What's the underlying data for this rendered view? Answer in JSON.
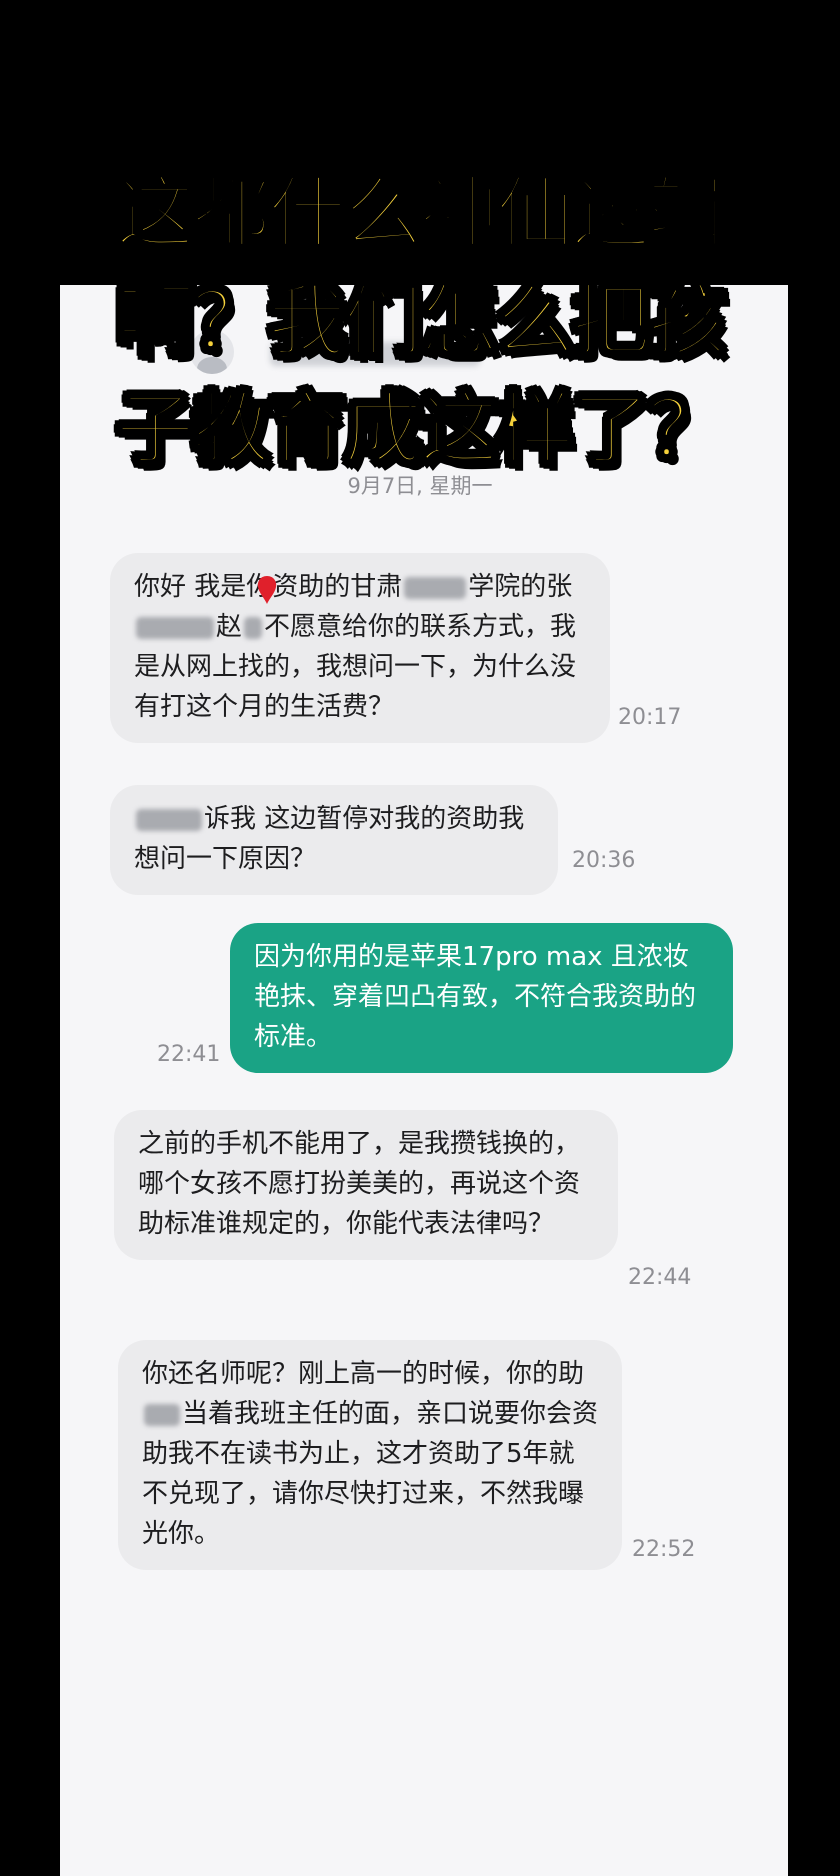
{
  "overlay": {
    "lines": [
      "这都什么神仙逻辑",
      "啊？我们怎么把孩",
      "子教育成这样了？"
    ]
  },
  "chat": {
    "date": "9月7日, 星期一",
    "messages": [
      {
        "dir": "in",
        "parts": [
          "你好 我是你资助的甘肃",
          "学院的张",
          "赵",
          "不愿意给你的联系方式，我是从网上找的，我想问一下，为什么没有打这个月的生活费？"
        ],
        "time": "20:17"
      },
      {
        "dir": "in",
        "parts": [
          "诉我 这边暂停对我的资助我想问一下原因？"
        ],
        "time": "20:36"
      },
      {
        "dir": "out",
        "text": "因为你用的是苹果17pro max 且浓妆艳抹、穿着凹凸有致，不符合我资助的标准。",
        "time": "22:41"
      },
      {
        "dir": "in",
        "text": "之前的手机不能用了，是我攒钱换的，哪个女孩不愿打扮美美的，再说这个资助标准谁规定的，你能代表法律吗？",
        "time": "22:44"
      },
      {
        "dir": "in",
        "parts": [
          "你还名师呢？刚上高一的时候，你的助",
          "当着我班主任的面，亲口说要你会资助我不在读书为止，这才资助了5年就不兑现了，请你尽快打过来，不然我曝光你。"
        ],
        "time": "22:52"
      }
    ]
  },
  "colors": {
    "overlay_text": "#f5d13b",
    "outgoing_bubble": "#1aa385",
    "incoming_bubble": "#ebebed"
  }
}
